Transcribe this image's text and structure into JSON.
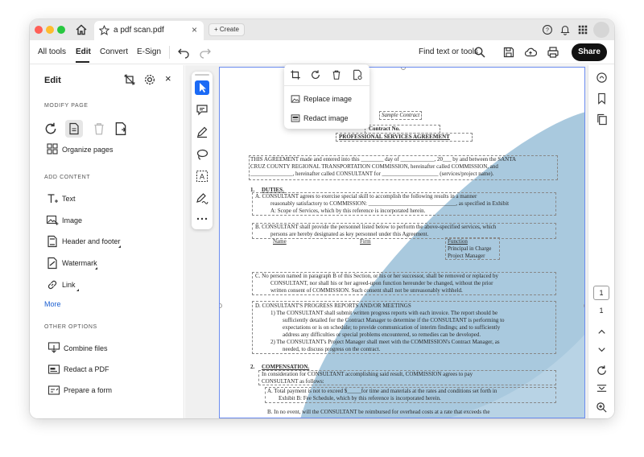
{
  "browser": {
    "tab_title": "a pdf scan.pdf",
    "tab_close": "×",
    "new_tab_label": "Create"
  },
  "toolbar": {
    "menus": [
      "All tools",
      "Edit",
      "Convert",
      "E-Sign"
    ],
    "find_label": "Find text or tools",
    "share_label": "Share"
  },
  "panel": {
    "title": "Edit",
    "close": "×",
    "modify_heading": "MODIFY PAGE",
    "organize_label": "Organize pages",
    "add_heading": "ADD CONTENT",
    "add_items": [
      "Text",
      "Image",
      "Header and footer",
      "Watermark",
      "Link"
    ],
    "more_label": "More",
    "other_heading": "OTHER OPTIONS",
    "other_items": [
      "Combine files",
      "Redact a PDF",
      "Prepare a form"
    ]
  },
  "popup": {
    "replace_label": "Replace image",
    "redact_label": "Redact image"
  },
  "document": {
    "sample": "Sample Contract",
    "contract_no": "Contract No.",
    "title": "PROFESSIONAL SERVICES AGREEMENT",
    "intro_1": "THIS AGREEMENT made and entered into this ________ day of ____________, 20___ by and between the SANTA",
    "intro_2": "CRUZ COUNTY REGIONAL TRANSPORTATION COMMISSION, hereinafter called COMMISSION, and",
    "intro_3": "_______________, hereinafter called CONSULTANT for ____________________ (services/project name).",
    "s1_num": "1.",
    "s1_title": "DUTIES.",
    "s1a_1": "A.  CONSULTANT agrees to exercise special skill to accomplish the following results in a manner",
    "s1a_2": "reasonably satisfactory to COMMISSION: _______________________________, as specified in Exhibit",
    "s1a_3": "A: Scope of Services, which by this reference is incorporated herein.",
    "s1b_1": "B.  CONSULTANT shall provide the personnel listed below to perform the above-specified services, which",
    "s1b_2": "persons are hereby designated as key personnel under this Agreement.",
    "col_name": "Name",
    "col_firm": "Firm",
    "col_function": "Function",
    "role_1": "Principal in Charge",
    "role_2": "Project Manager",
    "s1c_1": "C.  No person named in paragraph B of this Section, or his or her successor, shall be removed or replaced by",
    "s1c_2": "CONSULTANT, nor shall his or her agreed-upon function hereunder be changed, without the prior",
    "s1c_3": "written consent of COMMISSION.  Such consent shall not be unreasonably withheld.",
    "s1d_1": "D.  CONSULTANT'S PROGRESS REPORTS AND/OR MEETINGS",
    "s1d_2": "1)  The CONSULTANT shall submit written progress reports with each invoice. The report should be",
    "s1d_3": "sufficiently detailed for the Contract Manager to determine if the CONSULTANT is performing to",
    "s1d_4": "expectations or is on schedule; to provide communication of interim findings; and to sufficiently",
    "s1d_5": "address any difficulties or special problems encountered, so remedies can be developed.",
    "s1d_6": "2)  The CONSULTANT's Project Manager shall meet with the COMMISSION's Contract Manager, as",
    "s1d_7": "needed, to discuss progress on the contract.",
    "s2_num": "2.",
    "s2_title": "COMPENSATION.",
    "s2_1": "In consideration for CONSULTANT accomplishing said result, COMMISSION agrees to pay",
    "s2_2": "CONSULTANT as follows:",
    "s2a_1": "A.  Total payment is not to exceed $_____for time and materials at the rates and conditions set forth in",
    "s2a_2": "Exhibit B: Fee Schedule, which by this reference is incorporated herein.",
    "s2b_1": "B.  In no event, will the CONSULTANT be reimbursed for overhead costs at a rate that exceeds the"
  },
  "rail": {
    "page_current": "1",
    "page_total": "1"
  },
  "colors": {
    "accent": "#1b6af5",
    "shape_blue": "#a9c9de",
    "link": "#1b5fd1"
  }
}
